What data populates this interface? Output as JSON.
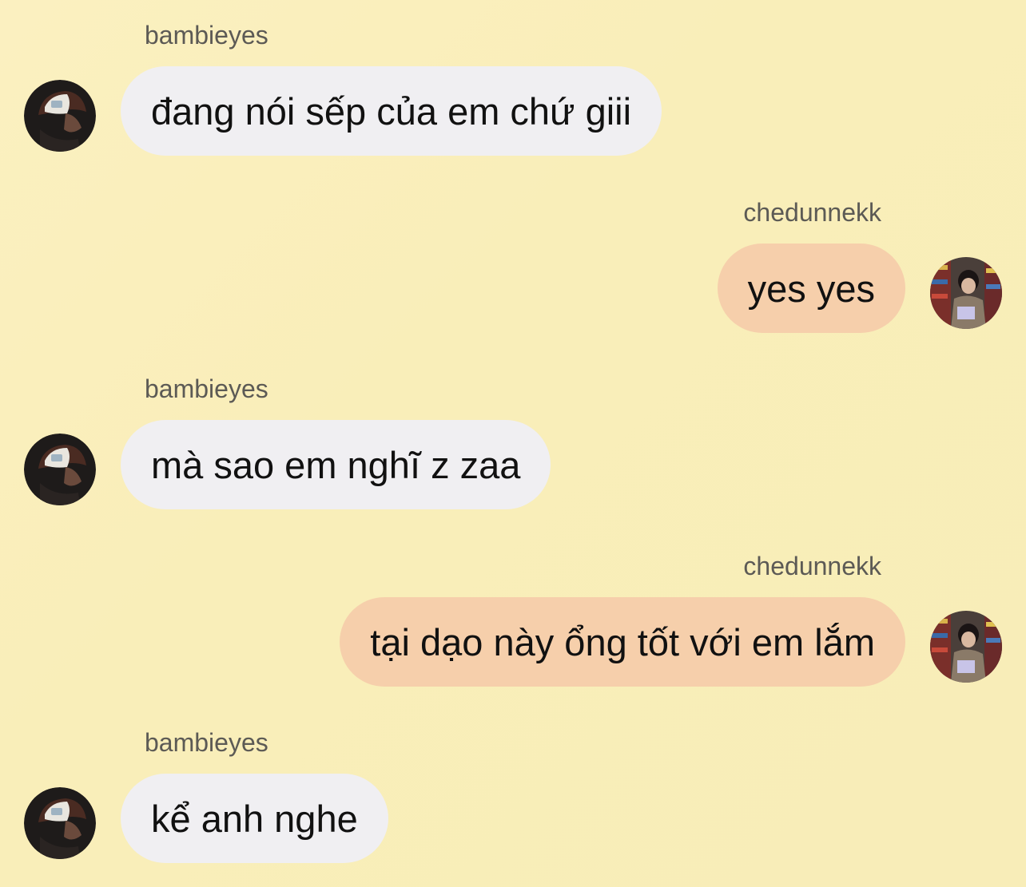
{
  "messages": [
    {
      "side": "left",
      "sender": "bambieyes",
      "text": "đang nói sếp của em chứ giii"
    },
    {
      "side": "right",
      "sender": "chedunnekk",
      "text": "yes yes"
    },
    {
      "side": "left",
      "sender": "bambieyes",
      "text": "mà sao em nghĩ z zaa"
    },
    {
      "side": "right",
      "sender": "chedunnekk",
      "text": "tại dạo này ổng tốt với em lắm"
    },
    {
      "side": "left",
      "sender": "bambieyes",
      "text": "kể anh nghe"
    }
  ],
  "avatars": {
    "bambieyes": {
      "icon": "avatar-cap-icon"
    },
    "chedunnekk": {
      "icon": "avatar-photo-icon"
    }
  },
  "colors": {
    "background": "#f9eeb9",
    "incoming_bubble": "#f0eff2",
    "outgoing_bubble": "#f6cfab",
    "sender_text": "#5c5a55",
    "message_text": "#111111"
  }
}
